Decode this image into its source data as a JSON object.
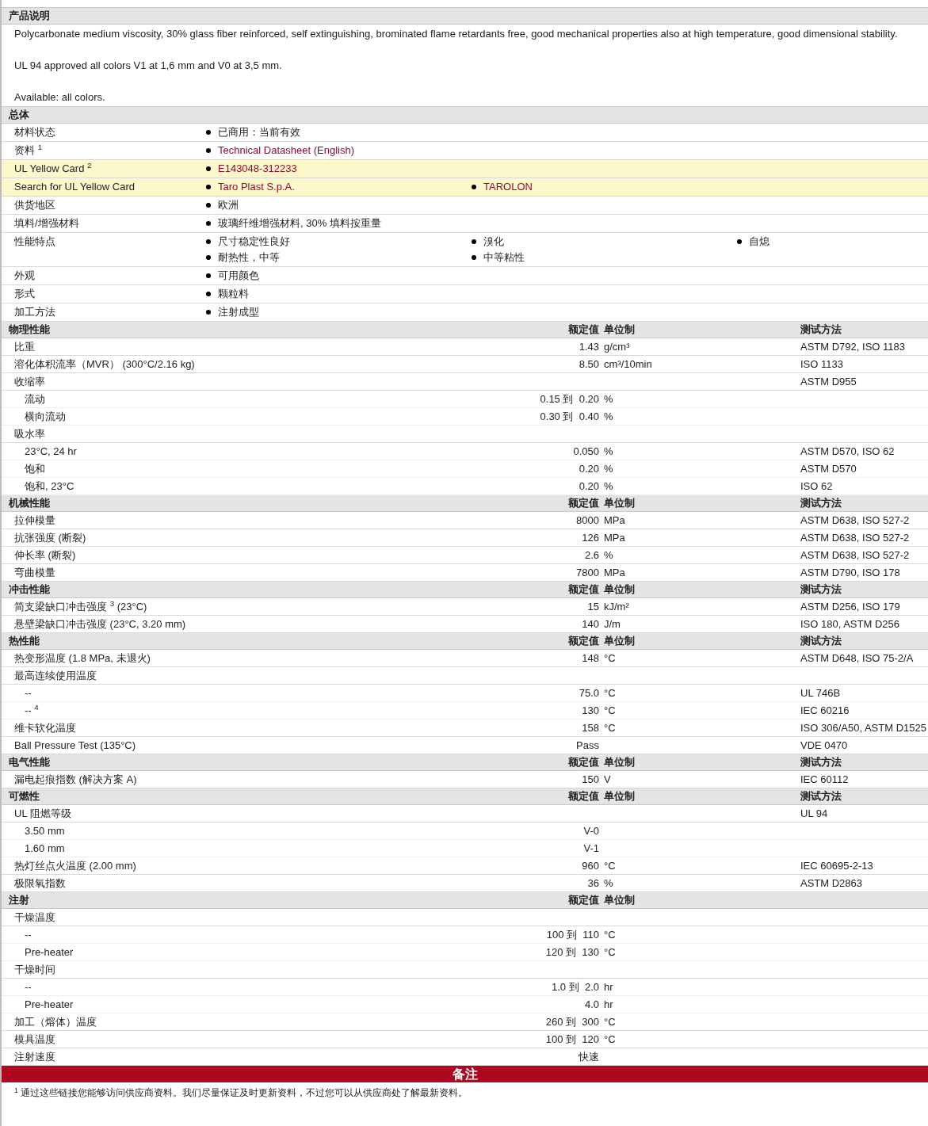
{
  "sections": [
    {
      "kind": "description",
      "title": "产品说明",
      "paragraphs": [
        "Polycarbonate medium viscosity, 30% glass fiber reinforced, self extinguishing, brominated flame retardants free, good mechanical properties also at high temperature, good dimensional stability.",
        "UL 94 approved all colors V1 at 1,6 mm and V0 at 3,5 mm.",
        "Available: all colors."
      ]
    },
    {
      "kind": "general",
      "title": "总体",
      "rows": [
        {
          "label": "材料状态",
          "highlighted": false,
          "items": [
            {
              "text": "已商用：当前有效",
              "link": false
            }
          ]
        },
        {
          "label": "资料 $^{1}$",
          "highlighted": false,
          "items": [
            {
              "text": "Technical Datasheet (English)",
              "link": true
            }
          ]
        },
        {
          "label": "UL Yellow Card $^{2}$",
          "highlighted": true,
          "items": [
            {
              "text": "E143048-312233",
              "link": true
            }
          ]
        },
        {
          "label": "Search for UL Yellow Card",
          "highlighted": true,
          "items": [
            {
              "text": "Taro Plast S.p.A.",
              "link": true
            },
            {
              "text": "TAROLON",
              "link": true
            }
          ]
        },
        {
          "label": "供货地区",
          "highlighted": false,
          "items": [
            {
              "text": "欧洲",
              "link": false
            }
          ]
        },
        {
          "label": "填料/增强材料",
          "highlighted": false,
          "items": [
            {
              "text": "玻璃纤维增强材料, 30% 填料按重量",
              "link": false
            }
          ]
        },
        {
          "label": "性能特点",
          "highlighted": false,
          "items": [
            {
              "text": "尺寸稳定性良好",
              "link": false
            },
            {
              "text": "溴化",
              "link": false
            },
            {
              "text": "自熄",
              "link": false
            },
            {
              "text": "耐热性，中等",
              "link": false
            },
            {
              "text": "中等粘性",
              "link": false
            }
          ]
        },
        {
          "label": "外观",
          "highlighted": false,
          "items": [
            {
              "text": "可用颜色",
              "link": false
            }
          ]
        },
        {
          "label": "形式",
          "highlighted": false,
          "items": [
            {
              "text": "颗粒料",
              "link": false
            }
          ]
        },
        {
          "label": "加工方法",
          "highlighted": false,
          "items": [
            {
              "text": "注射成型",
              "link": false
            }
          ]
        }
      ]
    },
    {
      "kind": "properties",
      "title": "物理性能",
      "value_header": "额定值",
      "unit_header": "单位制",
      "method_header": "测试方法",
      "rows": [
        {
          "label": "比重",
          "value": "1.43",
          "unit": "g/cm³",
          "method": "ASTM D792, ISO 1183"
        },
        {
          "label": "溶化体积流率（MVR） (300°C/2.16 kg)",
          "value": "8.50",
          "unit": "cm³/10min",
          "method": "ISO 1133"
        },
        {
          "label": "收缩率",
          "method": "ASTM D955",
          "children": [
            {
              "label": "流动",
              "value": "0.15 到  0.20",
              "unit": "%"
            },
            {
              "label": "横向流动",
              "value": "0.30 到  0.40",
              "unit": "%"
            }
          ]
        },
        {
          "label": "吸水率",
          "children": [
            {
              "label": "23°C, 24 hr",
              "value": "0.050",
              "unit": "%",
              "method": "ASTM D570, ISO 62"
            },
            {
              "label": "饱和",
              "value": "0.20",
              "unit": "%",
              "method": "ASTM D570"
            },
            {
              "label": "饱和, 23°C",
              "value": "0.20",
              "unit": "%",
              "method": "ISO 62"
            }
          ]
        }
      ]
    },
    {
      "kind": "properties",
      "title": "机械性能",
      "value_header": "额定值",
      "unit_header": "单位制",
      "method_header": "测试方法",
      "rows": [
        {
          "label": "拉伸模量",
          "value": "8000",
          "unit": "MPa",
          "method": "ASTM D638, ISO 527-2"
        },
        {
          "label": "抗张强度 (断裂)",
          "value": "126",
          "unit": "MPa",
          "method": "ASTM D638, ISO 527-2"
        },
        {
          "label": "伸长率 (断裂)",
          "value": "2.6",
          "unit": "%",
          "method": "ASTM D638, ISO 527-2"
        },
        {
          "label": "弯曲模量",
          "value": "7800",
          "unit": "MPa",
          "method": "ASTM D790, ISO 178"
        }
      ]
    },
    {
      "kind": "properties",
      "title": "冲击性能",
      "value_header": "额定值",
      "unit_header": "单位制",
      "method_header": "测试方法",
      "rows": [
        {
          "label": "简支梁缺口冲击强度 $^{3}$ (23°C)",
          "value": "15",
          "unit": "kJ/m²",
          "method": "ASTM D256, ISO 179"
        },
        {
          "label": "悬壁梁缺口冲击强度 (23°C, 3.20 mm)",
          "value": "140",
          "unit": "J/m",
          "method": "ISO 180, ASTM D256"
        }
      ]
    },
    {
      "kind": "properties",
      "title": "热性能",
      "value_header": "额定值",
      "unit_header": "单位制",
      "method_header": "测试方法",
      "rows": [
        {
          "label": "热变形温度 (1.8 MPa, 未退火)",
          "value": "148",
          "unit": "°C",
          "method": "ASTM D648, ISO 75-2/A"
        },
        {
          "label": "最高连续使用温度",
          "children": [
            {
              "label": "--",
              "value": "75.0",
              "unit": "°C",
              "method": "UL 746B"
            },
            {
              "label": "-- $^{4}$",
              "value": "130",
              "unit": "°C",
              "method": "IEC 60216"
            }
          ]
        },
        {
          "label": "维卡软化温度",
          "value": "158",
          "unit": "°C",
          "method": "ISO 306/A50, ASTM D1525"
        },
        {
          "label": "Ball Pressure Test (135°C)",
          "value": "Pass",
          "method": "VDE 0470"
        }
      ]
    },
    {
      "kind": "properties",
      "title": "电气性能",
      "value_header": "额定值",
      "unit_header": "单位制",
      "method_header": "测试方法",
      "rows": [
        {
          "label": "漏电起痕指数 (解决方案 A)",
          "value": "150",
          "unit": "V",
          "method": "IEC 60112"
        }
      ]
    },
    {
      "kind": "properties",
      "title": "可燃性",
      "value_header": "额定值",
      "unit_header": "单位制",
      "method_header": "测试方法",
      "rows": [
        {
          "label": "UL 阻燃等级",
          "method": "UL 94",
          "children": [
            {
              "label": "3.50 mm",
              "value": "V-0"
            },
            {
              "label": "1.60 mm",
              "value": "V-1"
            }
          ]
        },
        {
          "label": "热灯丝点火温度 (2.00 mm)",
          "value": "960",
          "unit": "°C",
          "method": "IEC 60695-2-13"
        },
        {
          "label": "极限氧指数",
          "value": "36",
          "unit": "%",
          "method": "ASTM D2863"
        }
      ]
    },
    {
      "kind": "properties",
      "title": "注射",
      "value_header": "额定值",
      "unit_header": "单位制",
      "rows": [
        {
          "label": "干燥温度",
          "children": [
            {
              "label": "--",
              "value": "100 到  110",
              "unit": "°C"
            },
            {
              "label": "Pre-heater",
              "value": "120 到  130",
              "unit": "°C"
            }
          ]
        },
        {
          "label": "干燥时间",
          "children": [
            {
              "label": "--",
              "value": "1.0 到  2.0",
              "unit": "hr"
            },
            {
              "label": "Pre-heater",
              "value": "4.0",
              "unit": "hr"
            }
          ]
        },
        {
          "label": "加工（熔体）温度",
          "value": "260 到  300",
          "unit": "°C"
        },
        {
          "label": "模具温度",
          "value": "100 到  120",
          "unit": "°C"
        },
        {
          "label": "注射速度",
          "value": "快速"
        }
      ]
    },
    {
      "kind": "notes",
      "title": "备注",
      "notes": [
        "$^{1}$ 通过这些链接您能够访问供应商资料。我们尽量保证及时更新资料，不过您可以从供应商处了解最新资料。"
      ]
    }
  ]
}
